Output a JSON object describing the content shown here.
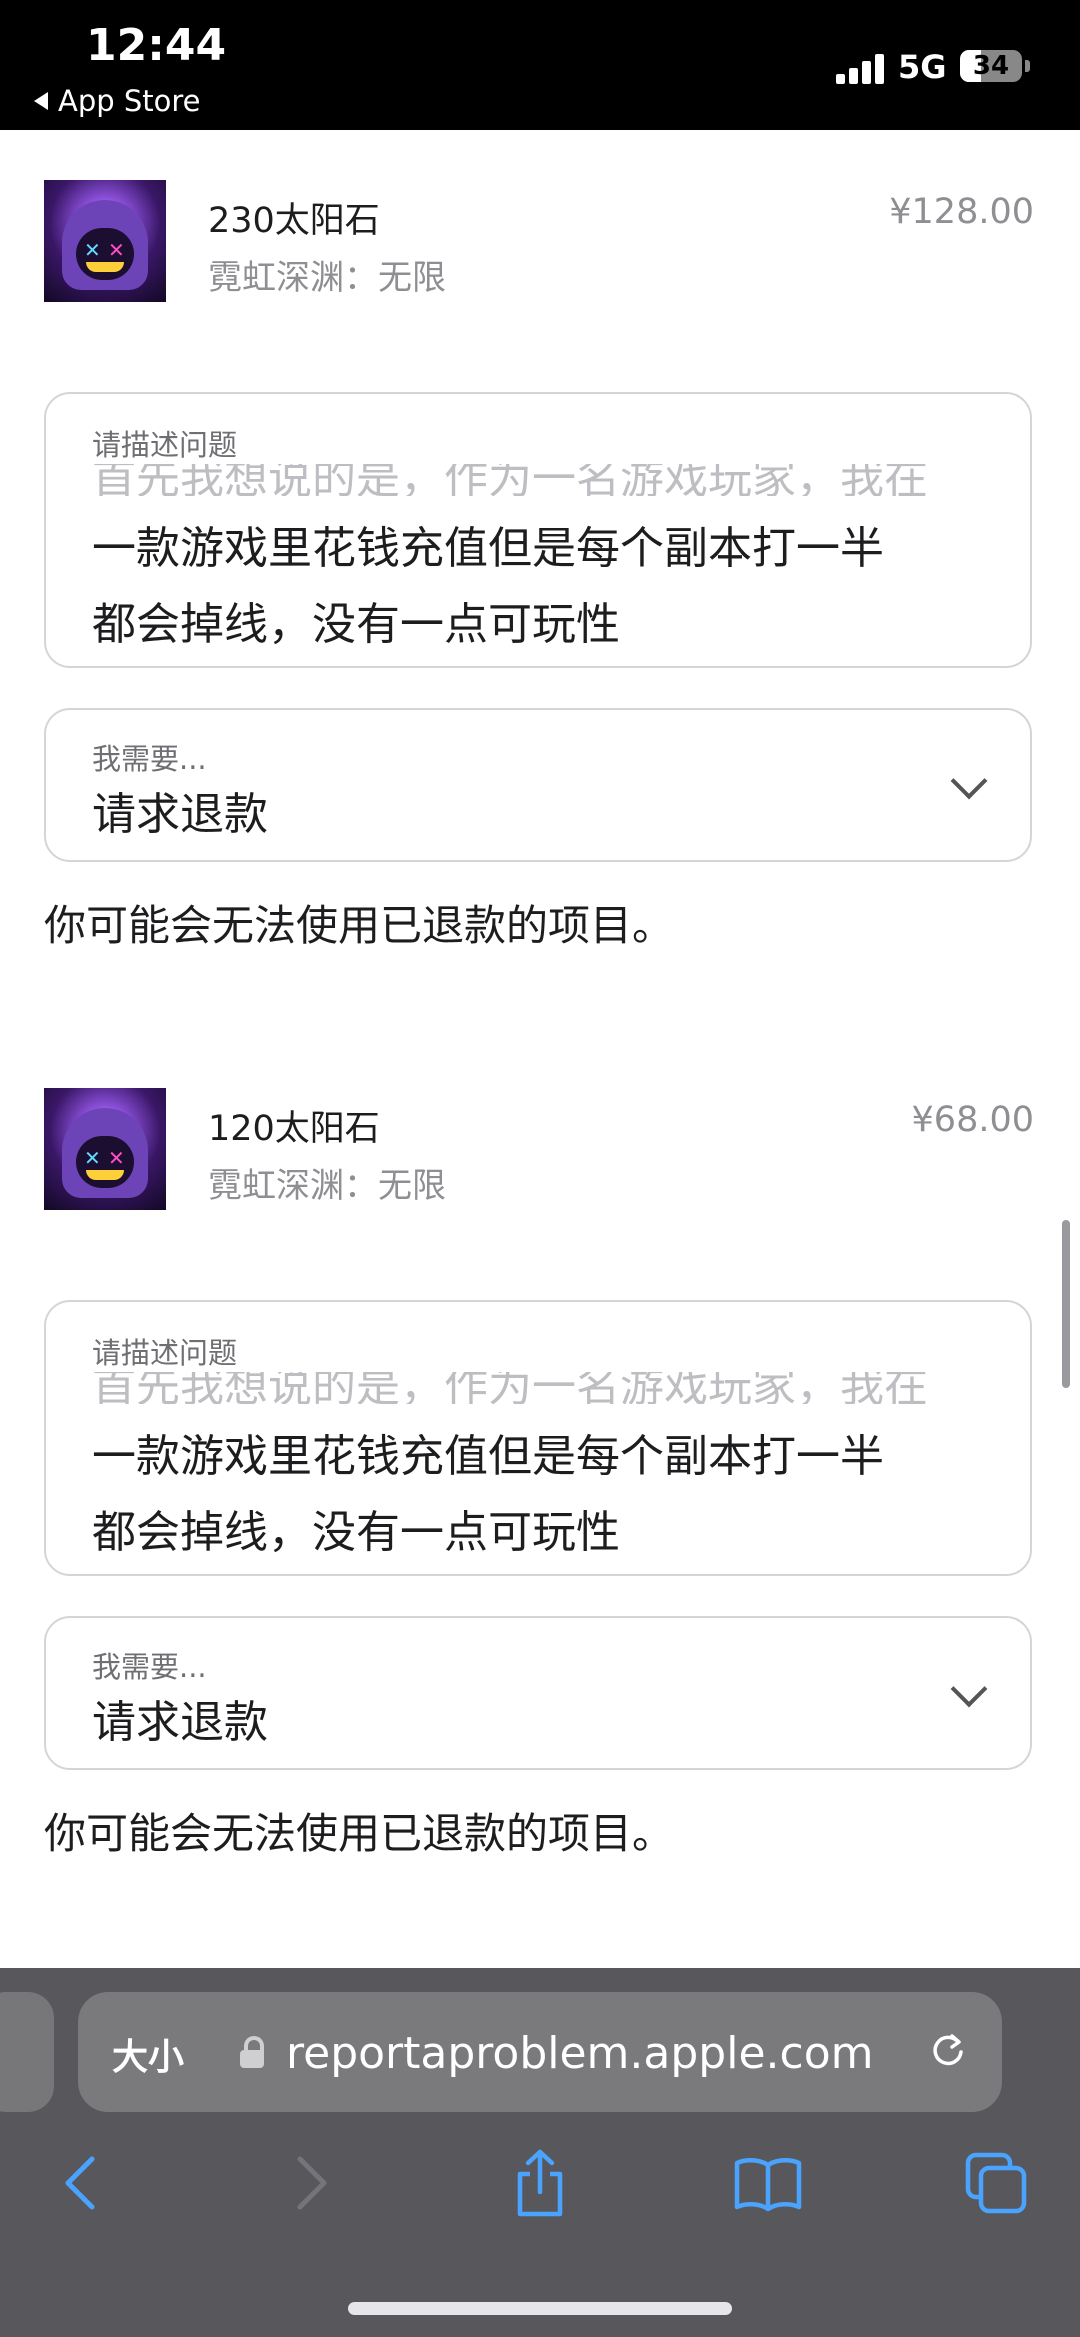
{
  "status_bar": {
    "time": "12:44",
    "back_label": "App Store",
    "network": "5G",
    "battery": "34",
    "battery_level": 0.34
  },
  "purchases": [
    {
      "item_name": "230太阳石",
      "app_name": "霓虹深渊：无限",
      "price": "¥128.00",
      "description_label": "请描述问题",
      "description_hidden_line": "首先我想说的是，作为一名游戏玩家，我在",
      "description_line1": "一款游戏里花钱充值但是每个副本打一半",
      "description_line2": "都会掉线，没有一点可玩性",
      "request_label": "我需要...",
      "request_value": "请求退款",
      "warning": "你可能会无法使用已退款的项目。"
    },
    {
      "item_name": "120太阳石",
      "app_name": "霓虹深渊：无限",
      "price": "¥68.00",
      "description_label": "请描述问题",
      "description_hidden_line": "首先我想说的是，作为一名游戏玩家，我在",
      "description_line1": "一款游戏里花钱充值但是每个副本打一半",
      "description_line2": "都会掉线，没有一点可玩性",
      "request_label": "我需要...",
      "request_value": "请求退款",
      "warning": "你可能会无法使用已退款的项目。"
    }
  ],
  "browser": {
    "text_size_button": "大小",
    "url": "reportaproblem.apple.com",
    "icons": [
      "lock-icon",
      "reload-icon",
      "back-icon",
      "forward-icon",
      "share-icon",
      "bookmarks-icon",
      "tabs-icon"
    ]
  }
}
